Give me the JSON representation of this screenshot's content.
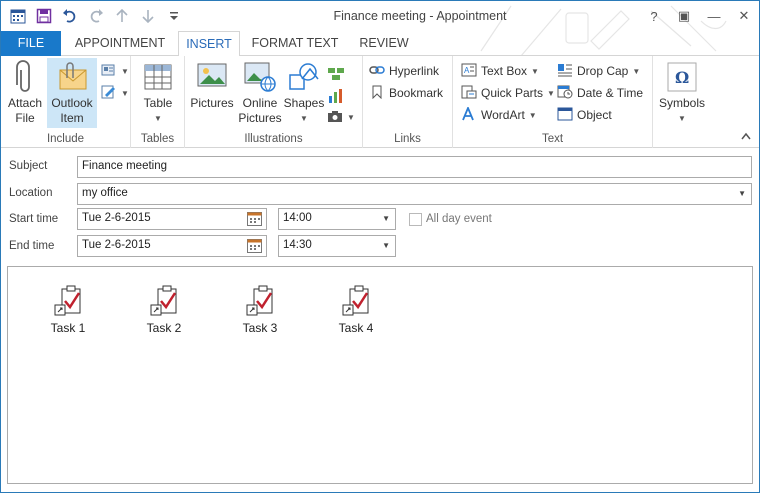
{
  "window": {
    "title": "Finance meeting - Appointment",
    "controls": [
      "?",
      "▣",
      "—",
      "✕"
    ]
  },
  "tabs": {
    "file": "FILE",
    "appointment": "APPOINTMENT",
    "insert": "INSERT",
    "format_text": "FORMAT TEXT",
    "review": "REVIEW"
  },
  "ribbon": {
    "include": {
      "label": "Include",
      "attach_file": [
        "Attach",
        "File"
      ],
      "outlook_item": [
        "Outlook",
        "Item"
      ]
    },
    "tables": {
      "label": "Tables",
      "table": "Table"
    },
    "illustrations": {
      "label": "Illustrations",
      "pictures": "Pictures",
      "online_pictures": [
        "Online",
        "Pictures"
      ],
      "shapes": "Shapes"
    },
    "links": {
      "label": "Links",
      "hyperlink": "Hyperlink",
      "bookmark": "Bookmark"
    },
    "text": {
      "label": "Text",
      "text_box": "Text Box",
      "quick_parts": "Quick Parts",
      "wordart": "WordArt",
      "drop_cap": "Drop Cap",
      "date_time": "Date & Time",
      "object": "Object"
    },
    "symbols": {
      "label": "Symbols"
    }
  },
  "form": {
    "subject_label": "Subject",
    "subject_value": "Finance meeting",
    "location_label": "Location",
    "location_value": "my office",
    "start_label": "Start time",
    "start_date": "Tue 2-6-2015",
    "start_time": "14:00",
    "all_day_label": "All day event",
    "all_day_checked": false,
    "end_label": "End time",
    "end_date": "Tue 2-6-2015",
    "end_time": "14:30"
  },
  "body": {
    "attachments": [
      {
        "name": "Task 1"
      },
      {
        "name": "Task 2"
      },
      {
        "name": "Task 3"
      },
      {
        "name": "Task 4"
      }
    ]
  },
  "colors": {
    "accent": "#1979ca",
    "active_tab_text": "#2a6bb8",
    "highlight": "#cde6f7",
    "checkmark": "#c0212e"
  },
  "icons": {
    "qat": [
      "calendar-icon",
      "save-icon",
      "undo-icon",
      "redo-icon",
      "up-arrow-icon",
      "down-arrow-icon",
      "customize-icon"
    ]
  }
}
